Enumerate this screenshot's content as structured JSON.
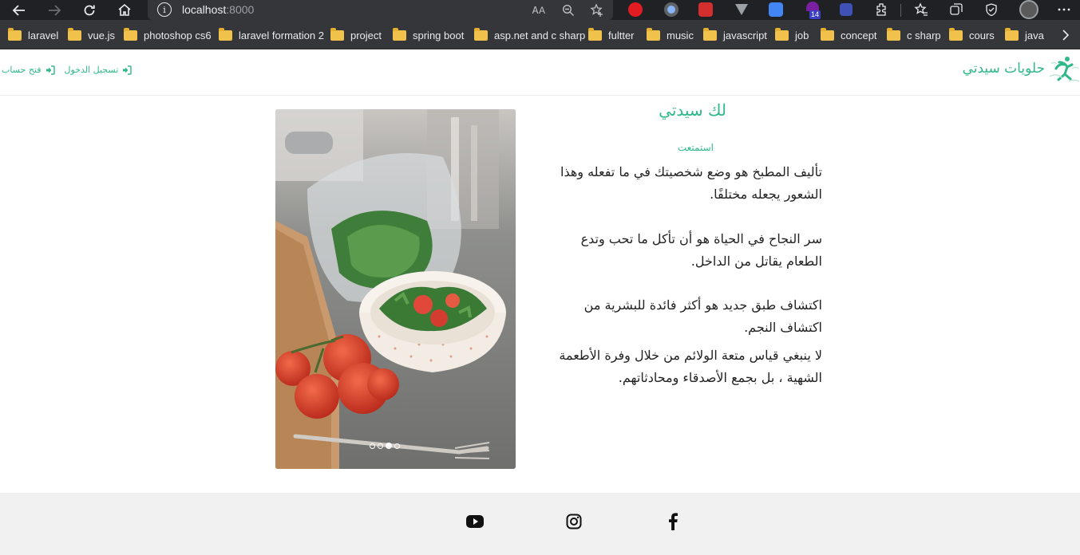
{
  "browser": {
    "url_host": "localhost",
    "url_port": ":8000",
    "read_aloud_label": "ᎪA",
    "extension_badge": "14",
    "bookmarks": [
      "laravel",
      "vue.js",
      "photoshop cs6",
      "laravel formation 2",
      "project",
      "spring boot",
      "asp.net and c sharp",
      "fultter",
      "music",
      "javascript",
      "job",
      "concept",
      "c sharp",
      "cours",
      "java"
    ],
    "icons": [
      "back-icon",
      "forward-icon",
      "reload-icon",
      "home-icon",
      "info-icon",
      "zoom-out-icon",
      "add-favorite-icon",
      "favorites-icon",
      "collections-icon",
      "extensions-icon",
      "profile-avatar",
      "menu-icon"
    ]
  },
  "header": {
    "brand": "حلويات سيدتي",
    "login": "تسجيل الدخول",
    "register": "فتح حساب"
  },
  "content": {
    "title": "لك سيدتي",
    "subtitle": "استمتعت",
    "quotes": [
      "تأليف المطبخ هو وضع شخصيتك في ما تفعله وهذا الشعور يجعله مختلفًا.",
      "سر النجاح في الحياة هو أن تأكل ما تحب وتدع الطعام يقاتل من الداخل.",
      "اكتشاف طبق جديد هو أكثر فائدة للبشرية من اكتشاف النجم.",
      "لا ينبغي قياس متعة الولائم من خلال وفرة الأطعمة الشهية ، بل بجمع الأصدقاء ومحادثاتهم."
    ]
  },
  "slider": {
    "slide_count": 4,
    "active_index": 2
  },
  "footer": {
    "social": [
      "youtube-icon",
      "instagram-icon",
      "facebook-icon"
    ]
  },
  "colors": {
    "accent": "#2fb888",
    "chrome_dark": "#202124",
    "bookmark_bar": "#35363a",
    "footer_bg": "#f1f1f1"
  }
}
